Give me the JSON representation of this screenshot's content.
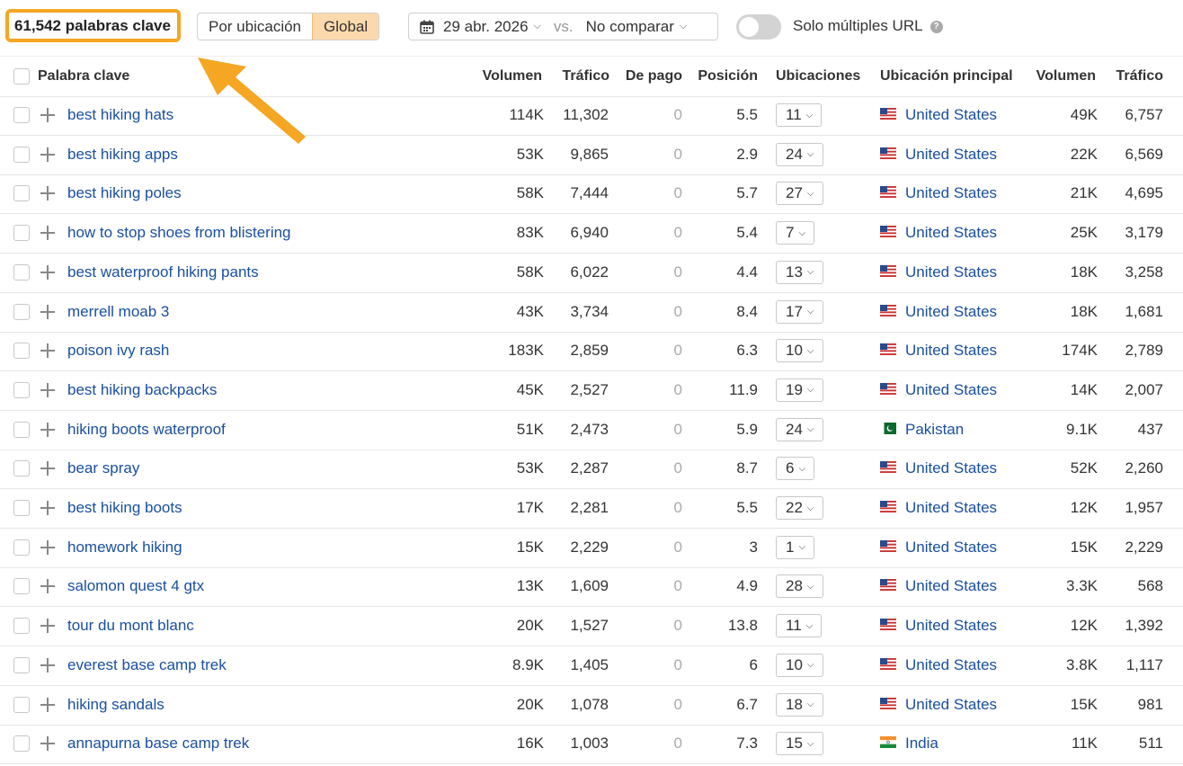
{
  "toolbar": {
    "keyword_count": "61,542 palabras clave",
    "segment": [
      "Por ubicación",
      "Global"
    ],
    "date": "29 abr. 2026",
    "vs": "vs.",
    "compare": "No comparar",
    "toggle_label": "Solo múltiples URL",
    "help": "?"
  },
  "columns": {
    "keyword": "Palabra clave",
    "volume": "Volumen",
    "traffic": "Tráfico",
    "paid": "De pago",
    "position": "Posición",
    "locations": "Ubicaciones",
    "main_location": "Ubicación principal",
    "volume2": "Volumen",
    "traffic2": "Tráfico"
  },
  "rows": [
    {
      "kw": "best hiking hats",
      "vol": "114K",
      "traf": "11,302",
      "paid": "0",
      "pos": "5.5",
      "locs": "11",
      "flag": "us",
      "country": "United States",
      "vol2": "49K",
      "traf2": "6,757"
    },
    {
      "kw": "best hiking apps",
      "vol": "53K",
      "traf": "9,865",
      "paid": "0",
      "pos": "2.9",
      "locs": "24",
      "flag": "us",
      "country": "United States",
      "vol2": "22K",
      "traf2": "6,569"
    },
    {
      "kw": "best hiking poles",
      "vol": "58K",
      "traf": "7,444",
      "paid": "0",
      "pos": "5.7",
      "locs": "27",
      "flag": "us",
      "country": "United States",
      "vol2": "21K",
      "traf2": "4,695"
    },
    {
      "kw": "how to stop shoes from blistering",
      "vol": "83K",
      "traf": "6,940",
      "paid": "0",
      "pos": "5.4",
      "locs": "7",
      "flag": "us",
      "country": "United States",
      "vol2": "25K",
      "traf2": "3,179"
    },
    {
      "kw": "best waterproof hiking pants",
      "vol": "58K",
      "traf": "6,022",
      "paid": "0",
      "pos": "4.4",
      "locs": "13",
      "flag": "us",
      "country": "United States",
      "vol2": "18K",
      "traf2": "3,258"
    },
    {
      "kw": "merrell moab 3",
      "vol": "43K",
      "traf": "3,734",
      "paid": "0",
      "pos": "8.4",
      "locs": "17",
      "flag": "us",
      "country": "United States",
      "vol2": "18K",
      "traf2": "1,681"
    },
    {
      "kw": "poison ivy rash",
      "vol": "183K",
      "traf": "2,859",
      "paid": "0",
      "pos": "6.3",
      "locs": "10",
      "flag": "us",
      "country": "United States",
      "vol2": "174K",
      "traf2": "2,789"
    },
    {
      "kw": "best hiking backpacks",
      "vol": "45K",
      "traf": "2,527",
      "paid": "0",
      "pos": "11.9",
      "locs": "19",
      "flag": "us",
      "country": "United States",
      "vol2": "14K",
      "traf2": "2,007"
    },
    {
      "kw": "hiking boots waterproof",
      "vol": "51K",
      "traf": "2,473",
      "paid": "0",
      "pos": "5.9",
      "locs": "24",
      "flag": "pk",
      "country": "Pakistan",
      "vol2": "9.1K",
      "traf2": "437"
    },
    {
      "kw": "bear spray",
      "vol": "53K",
      "traf": "2,287",
      "paid": "0",
      "pos": "8.7",
      "locs": "6",
      "flag": "us",
      "country": "United States",
      "vol2": "52K",
      "traf2": "2,260"
    },
    {
      "kw": "best hiking boots",
      "vol": "17K",
      "traf": "2,281",
      "paid": "0",
      "pos": "5.5",
      "locs": "22",
      "flag": "us",
      "country": "United States",
      "vol2": "12K",
      "traf2": "1,957"
    },
    {
      "kw": "homework hiking",
      "vol": "15K",
      "traf": "2,229",
      "paid": "0",
      "pos": "3",
      "locs": "1",
      "flag": "us",
      "country": "United States",
      "vol2": "15K",
      "traf2": "2,229"
    },
    {
      "kw": "salomon quest 4 gtx",
      "vol": "13K",
      "traf": "1,609",
      "paid": "0",
      "pos": "4.9",
      "locs": "28",
      "flag": "us",
      "country": "United States",
      "vol2": "3.3K",
      "traf2": "568"
    },
    {
      "kw": "tour du mont blanc",
      "vol": "20K",
      "traf": "1,527",
      "paid": "0",
      "pos": "13.8",
      "locs": "11",
      "flag": "us",
      "country": "United States",
      "vol2": "12K",
      "traf2": "1,392"
    },
    {
      "kw": "everest base camp trek",
      "vol": "8.9K",
      "traf": "1,405",
      "paid": "0",
      "pos": "6",
      "locs": "10",
      "flag": "us",
      "country": "United States",
      "vol2": "3.8K",
      "traf2": "1,117"
    },
    {
      "kw": "hiking sandals",
      "vol": "20K",
      "traf": "1,078",
      "paid": "0",
      "pos": "6.7",
      "locs": "18",
      "flag": "us",
      "country": "United States",
      "vol2": "15K",
      "traf2": "981"
    },
    {
      "kw": "annapurna base camp trek",
      "vol": "16K",
      "traf": "1,003",
      "paid": "0",
      "pos": "7.3",
      "locs": "15",
      "flag": "in",
      "country": "India",
      "vol2": "11K",
      "traf2": "511"
    }
  ],
  "colors": {
    "accent": "#f5a623",
    "link": "#1a4fa0",
    "segment_active": "#fcd9ad"
  },
  "icons": {
    "calendar": "calendar-icon",
    "chevron": "chevron-down-icon",
    "plus": "plus-icon",
    "help": "help-icon"
  }
}
